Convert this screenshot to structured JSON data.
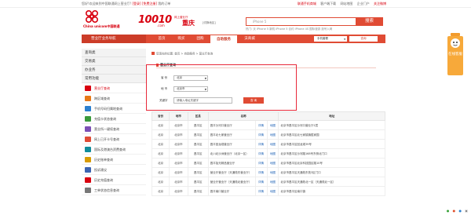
{
  "topbar": {
    "welcome": "您好!欢迎来到中国联通网上营业厅!",
    "login": "[登录]",
    "register": "[免费注册]",
    "my_orders": "我的订单",
    "links": [
      "联通手机商城",
      "客户端下载",
      "网站地图",
      "企业门户",
      "关注微博"
    ]
  },
  "header": {
    "logo_text": "China unicom中国联通",
    "brand_number": "10010",
    "brand_domain": ".com",
    "brand_slogan": "网上营业厅",
    "city": "重庆",
    "city_switch": "[切换地区]",
    "search": {
      "placeholder": "iPhone 5",
      "button": "搜索"
    },
    "hot_words": "热门: 沃 iPhone 5 新机 iPhone 5 合约 iPhone 4S 国际漫游 选号入网"
  },
  "nav": {
    "biz_title": "营业厅业务导航",
    "tabs": [
      "首页",
      "购买",
      "团购",
      "自助服务",
      "沃商城"
    ],
    "active_tab": "自助服务",
    "select_label": "手机套餐",
    "go_label": "查询"
  },
  "sidebar": {
    "heads": [
      "查询类",
      "交易类",
      "办业务",
      "常用功能"
    ],
    "items": [
      {
        "label": "营业厅查询",
        "color": "#d8000f"
      },
      {
        "label": "跨区域查询",
        "color": "#e77817"
      },
      {
        "label": "手机号码归属地查询",
        "color": "#2b7fcf"
      },
      {
        "label": "充值卡状态查询",
        "color": "#3a9a3a"
      },
      {
        "label": "营业所一键续查询",
        "color": "#7c4fb5"
      },
      {
        "label": "网上已开卡号查询",
        "color": "#e04b34"
      },
      {
        "label": "国际及港澳台资费查询",
        "color": "#0f8c9b"
      },
      {
        "label": "历史账单查询",
        "color": "#d89b00"
      },
      {
        "label": "投诉建议",
        "color": "#3c64b1"
      },
      {
        "label": "历史充值查询",
        "color": "#d8000f"
      },
      {
        "label": "工单状态信息查询",
        "color": "#777777"
      }
    ]
  },
  "breadcrumb": "您现在的位置: 首页 > 自助服务 > 营业厅查询",
  "form": {
    "title": "营业厅查询",
    "province_label": "省 份",
    "province_value": "北京",
    "city_label": "地 市",
    "city_value": "北京市",
    "keyword_label": "关键字",
    "keyword_placeholder": "请输入地址关键字",
    "query_button": "查 询"
  },
  "table": {
    "headers": [
      "省份",
      "地市",
      "区县",
      "名称",
      "",
      "",
      "地址"
    ],
    "detail_label": "详情",
    "map_label": "地图",
    "rows": [
      {
        "province": "北京",
        "city": "北京市",
        "district": "昌平区",
        "name": "昌平沙河口营业厅",
        "address": "北京市昌平区沙河口营业厅1层"
      },
      {
        "province": "北京",
        "city": "北京市",
        "district": "昌平区",
        "name": "昌平北七家营业厅",
        "address": "北京市昌平区北七家镇旗胜家园"
      },
      {
        "province": "北京",
        "city": "北京市",
        "district": "昌平区",
        "name": "昌平回龙观营业厅",
        "address": "北京市昌平区回龙观39号"
      },
      {
        "province": "北京",
        "city": "北京市",
        "district": "昌平区",
        "name": "北川北沙洲营业厅（北京一区）",
        "address": "北京市昌平区沙河路168号东侧北门口"
      },
      {
        "province": "北京",
        "city": "北京市",
        "district": "昌平区",
        "name": "昌平拾光精品营业厅",
        "address": "北京市昌平区北京科技园区路10号"
      },
      {
        "province": "北京",
        "city": "北京市",
        "district": "昌平区",
        "name": "营业厅营业厅（天通苑东营业厅）",
        "address": "北京市昌平区天通苑东苑3区门口"
      },
      {
        "province": "北京",
        "city": "北京市",
        "district": "昌平区",
        "name": "营业厅营业厅（天通苑北营业厅）",
        "address": "北京市昌平区天通苑北一区（天通苑北一区）"
      },
      {
        "province": "北京",
        "city": "北京市",
        "district": "昌平区",
        "name": "昌平南口营业厅",
        "address": "北京市昌平区南口镇"
      }
    ]
  },
  "float_service": "在线客服",
  "footer_icons": [
    "wechat-icon",
    "weibo-icon",
    "qq-icon",
    "print-icon"
  ]
}
